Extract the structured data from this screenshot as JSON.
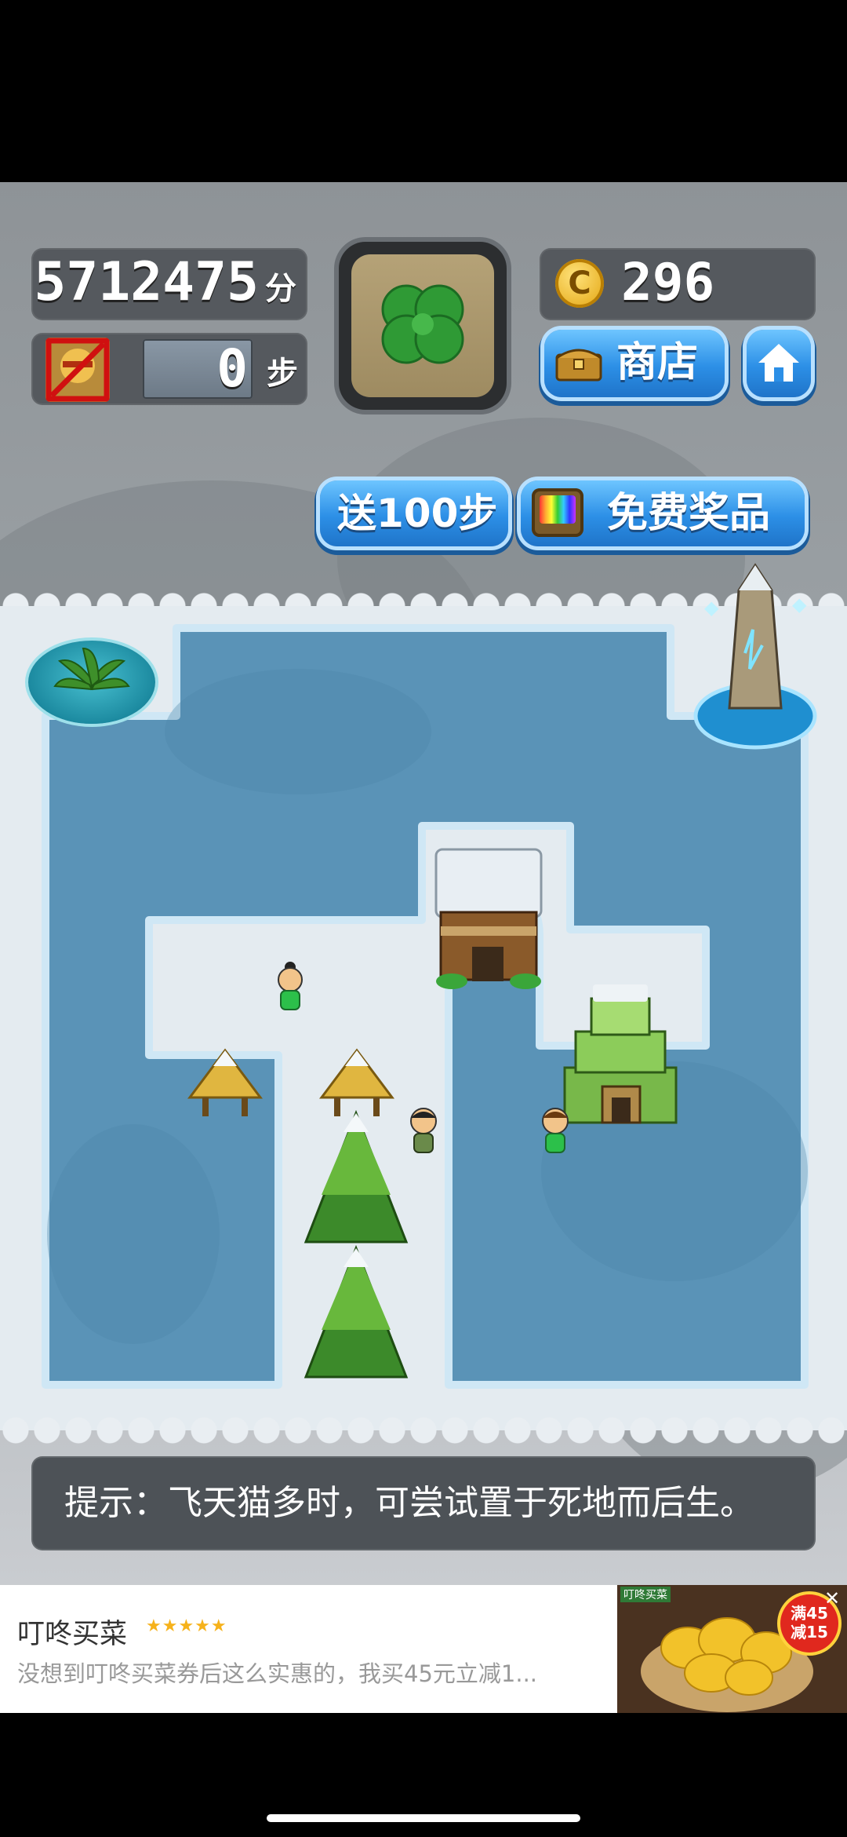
{
  "hud": {
    "score": "5712475",
    "score_unit": "分",
    "steps": "0",
    "steps_unit": "步",
    "coins": "296",
    "coin_symbol": "C"
  },
  "buttons": {
    "shop": "商店",
    "send_steps": "送100步",
    "free_prize": "免费奖品"
  },
  "tip": {
    "text": "提示：飞天猫多时，可尝试置于死地而后生。"
  },
  "ad": {
    "title": "叮咚买菜",
    "rating": "★★★★★",
    "description": "没想到叮咚买菜券后这么实惠的，我买45元立减1...",
    "badge_line1": "满45",
    "badge_line2": "减15",
    "brand_tag": "叮咚买菜"
  },
  "colors": {
    "ice": "#5a93b7",
    "snow": "#e6edf2",
    "panel": "#55595e",
    "button_blue": "#2c8fe6",
    "ad_star": "#f6b21b"
  }
}
